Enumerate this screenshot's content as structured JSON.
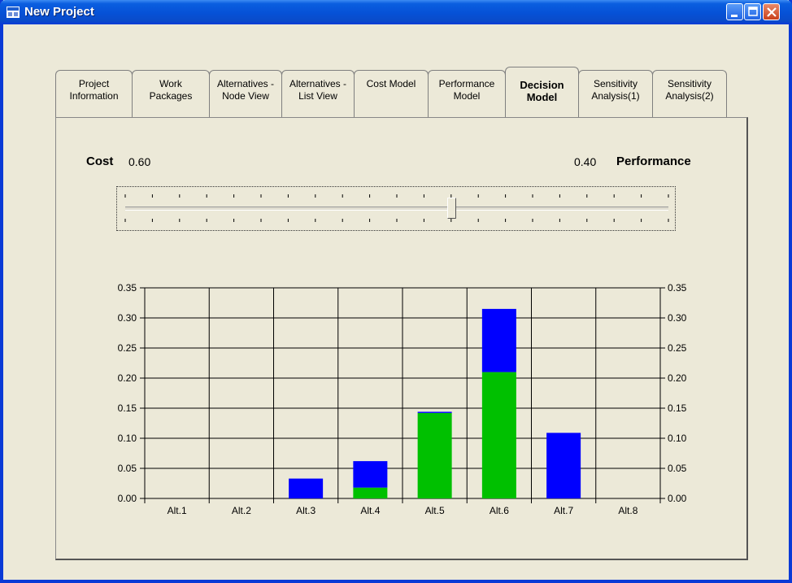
{
  "window": {
    "title": "New Project"
  },
  "tabs": [
    {
      "id": "project-information",
      "label": "Project\nInformation",
      "active": false
    },
    {
      "id": "work-packages",
      "label": "Work\nPackages",
      "active": false
    },
    {
      "id": "alternatives-node-view",
      "label": "Alternatives -\nNode View",
      "active": false
    },
    {
      "id": "alternatives-list-view",
      "label": "Alternatives -\nList View",
      "active": false
    },
    {
      "id": "cost-model",
      "label": "Cost Model",
      "active": false
    },
    {
      "id": "performance-model",
      "label": "Performance\nModel",
      "active": false
    },
    {
      "id": "decision-model",
      "label": "Decision\nModel",
      "active": true
    },
    {
      "id": "sensitivity-analysis-1",
      "label": "Sensitivity\nAnalysis(1)",
      "active": false
    },
    {
      "id": "sensitivity-analysis-2",
      "label": "Sensitivity\nAnalysis(2)",
      "active": false
    }
  ],
  "weights": {
    "cost_label": "Cost",
    "cost_value": "0.60",
    "performance_value": "0.40",
    "performance_label": "Performance",
    "slider_position": 0.6
  },
  "colors": {
    "cost": "#0000ff",
    "performance": "#00c000"
  },
  "chart_data": {
    "type": "bar",
    "stacked": true,
    "categories": [
      "Alt.1",
      "Alt.2",
      "Alt.3",
      "Alt.4",
      "Alt.5",
      "Alt.6",
      "Alt.7",
      "Alt.8"
    ],
    "series": [
      {
        "color": "#00c000",
        "values": [
          0,
          0,
          0,
          0.018,
          0.142,
          0.21,
          0,
          0
        ]
      },
      {
        "color": "#0000ff",
        "values": [
          0,
          0,
          0.033,
          0.044,
          0.002,
          0.105,
          0.109,
          0
        ]
      }
    ],
    "ylim": [
      0,
      0.35
    ],
    "yticks": [
      "0.00",
      "0.05",
      "0.10",
      "0.15",
      "0.20",
      "0.25",
      "0.30",
      "0.35"
    ],
    "grid": true,
    "right_axis": true
  }
}
